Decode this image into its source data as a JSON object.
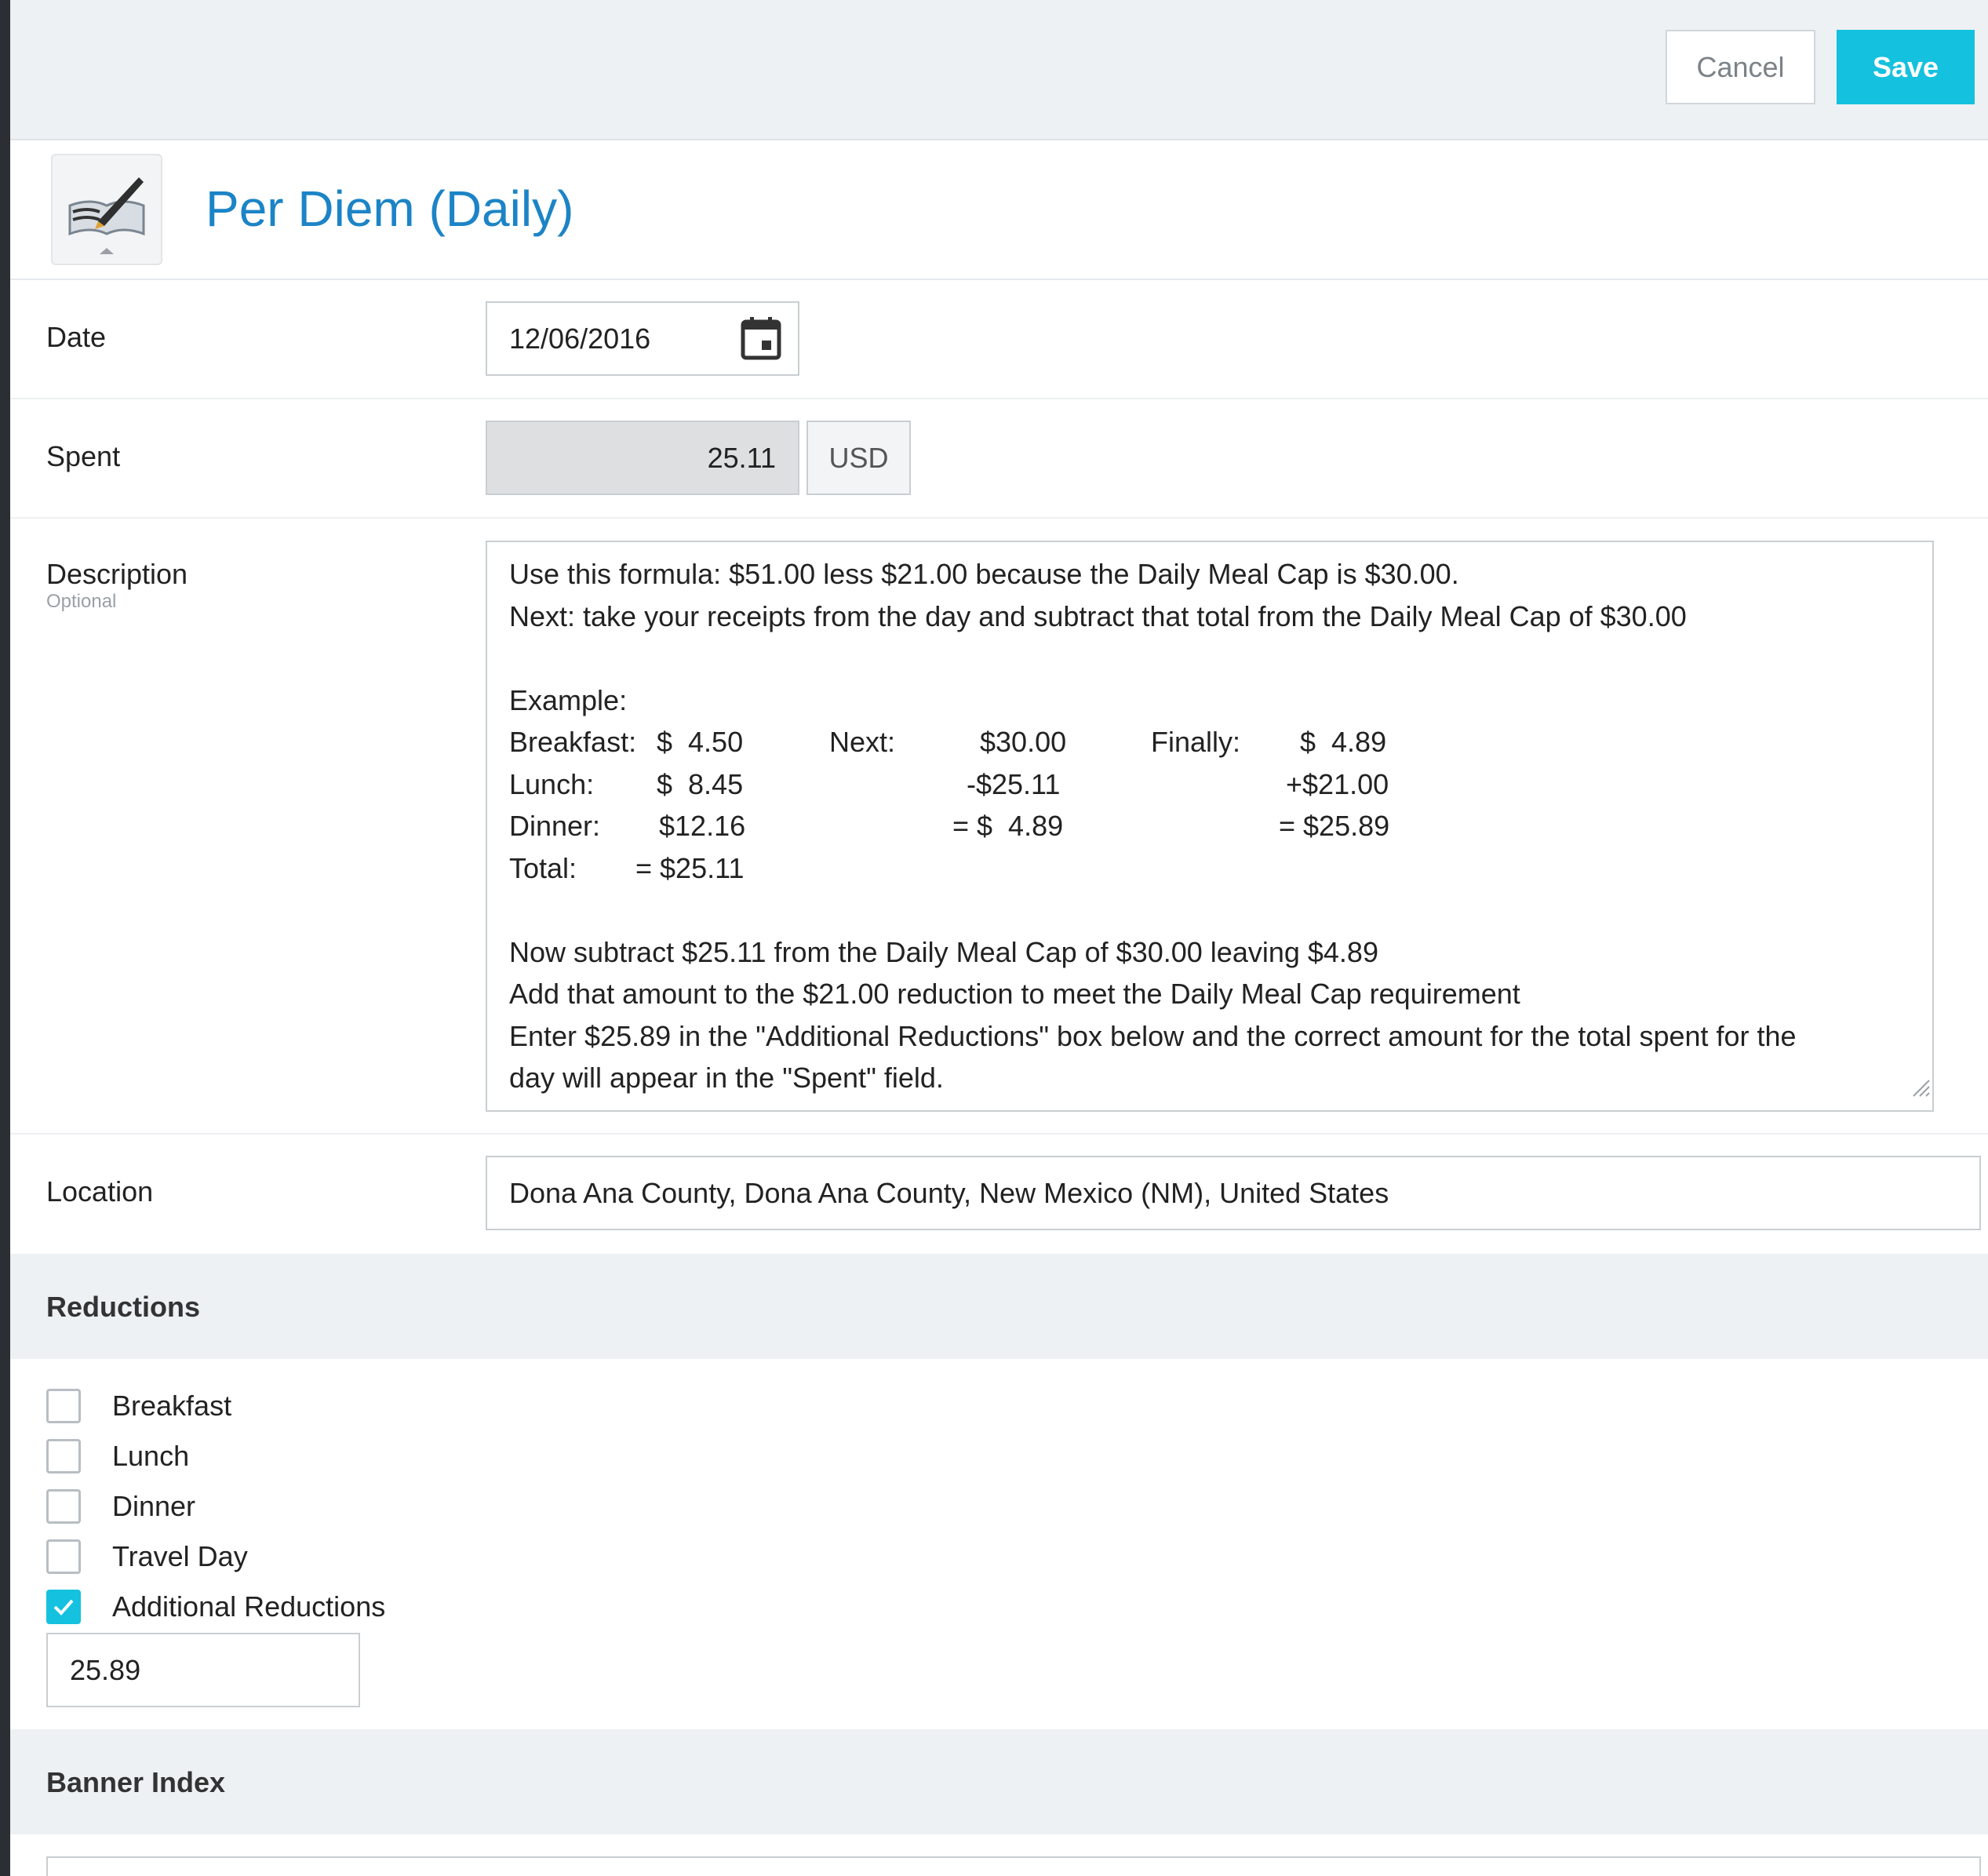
{
  "toolbar": {
    "cancel_label": "Cancel",
    "save_label": "Save"
  },
  "header": {
    "title": "Per Diem (Daily)",
    "icon": "expense-type-icon"
  },
  "form": {
    "date": {
      "label": "Date",
      "value": "12/06/2016",
      "icon": "calendar-icon"
    },
    "spent": {
      "label": "Spent",
      "value": "25.11",
      "currency": "USD"
    },
    "description": {
      "label": "Description",
      "optional": "Optional",
      "intro_lines": [
        "Use this formula: $51.00 less $21.00 because the Daily Meal Cap is $30.00.",
        "Next: take your receipts from the day and subtract that total from the Daily Meal Cap of $30.00"
      ],
      "example_label": "Example:",
      "example_rows": [
        {
          "c1": "Breakfast:",
          "c2": "$  4.50",
          "c3": "Next:",
          "c4": "$30.00",
          "c5": "Finally:",
          "c6": "$  4.89"
        },
        {
          "c1": "Lunch:",
          "c2": "$  8.45",
          "c3": "",
          "c4": "-$25.11",
          "c5": "",
          "c6": "+$21.00"
        },
        {
          "c1": "Dinner:",
          "c2": "$12.16",
          "c3": "",
          "c4": "= $  4.89",
          "c5": "",
          "c6": "= $25.89"
        },
        {
          "c1": "Total:",
          "c2": "= $25.11",
          "c3": "",
          "c4": "",
          "c5": "",
          "c6": ""
        }
      ],
      "outro_lines": [
        "Now subtract $25.11 from the Daily Meal Cap of $30.00 leaving $4.89",
        "Add that amount to the $21.00 reduction to meet the Daily Meal Cap requirement",
        "Enter $25.89 in the \"Additional Reductions\" box below and the correct amount for the total spent for the",
        "day will appear in the \"Spent\" field."
      ]
    },
    "location": {
      "label": "Location",
      "value": "Dona Ana County, Dona Ana County, New Mexico (NM), United States"
    }
  },
  "reductions": {
    "title": "Reductions",
    "items": [
      {
        "label": "Breakfast",
        "checked": false
      },
      {
        "label": "Lunch",
        "checked": false
      },
      {
        "label": "Dinner",
        "checked": false
      },
      {
        "label": "Travel Day",
        "checked": false
      },
      {
        "label": "Additional Reductions",
        "checked": true
      }
    ],
    "additional_value": "25.89"
  },
  "banner_index": {
    "title": "Banner Index"
  },
  "colors": {
    "accent": "#14c1df",
    "title_blue": "#1c84c6",
    "section_bg": "#edf1f4"
  }
}
